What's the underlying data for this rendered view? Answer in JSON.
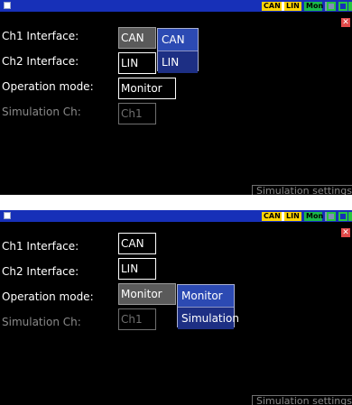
{
  "status": {
    "can": "CAN",
    "lin": "LIN",
    "mode": "Mon"
  },
  "colors": {
    "titlebar": "#1730b8",
    "chip": "#ffd400",
    "mode_chip": "#19b94a",
    "close": "#e04a4a",
    "dropdown": "#21358d"
  },
  "labels": {
    "ch1": "Ch1 Interface:",
    "ch2": "Ch2 Interface:",
    "mode": "Operation mode:",
    "sim_ch": "Simulation Ch:"
  },
  "panel1": {
    "ch1_value": "CAN",
    "ch2_value": "LIN",
    "mode_value": "Monitor",
    "sim_ch_value": "Ch1",
    "dropdown_options": [
      "CAN",
      "LIN"
    ],
    "sim_settings": "Simulation settings"
  },
  "panel2": {
    "ch1_value": "CAN",
    "ch2_value": "LIN",
    "mode_value": "Monitor",
    "sim_ch_value": "Ch1",
    "dropdown_options": [
      "Monitor",
      "Simulation"
    ],
    "sim_settings": "Simulation settings"
  }
}
